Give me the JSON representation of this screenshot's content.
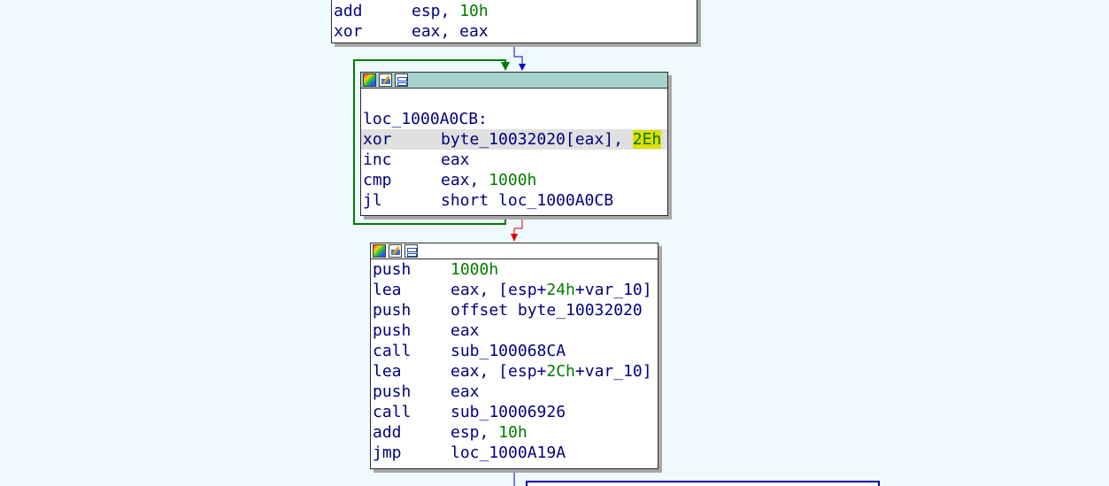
{
  "block_top": {
    "lines": [
      {
        "mnemonic": "add",
        "op1": "esp, ",
        "num": "10h",
        "op2": ""
      },
      {
        "mnemonic": "xor",
        "op1": "eax, eax",
        "num": "",
        "op2": ""
      }
    ]
  },
  "block_loop": {
    "label": "loc_1000A0CB:",
    "lines": [
      {
        "mnemonic": "xor",
        "op1": "byte_10032020[eax], ",
        "num": "2Eh",
        "op2": ""
      },
      {
        "mnemonic": "inc",
        "op1": "eax",
        "num": "",
        "op2": ""
      },
      {
        "mnemonic": "cmp",
        "op1": "eax, ",
        "num": "1000h",
        "op2": ""
      },
      {
        "mnemonic": "jl",
        "op1": "short loc_1000A0CB",
        "num": "",
        "op2": ""
      }
    ]
  },
  "block_bottom": {
    "lines": [
      {
        "mnemonic": "push",
        "op1": "",
        "num": "1000h",
        "op2": ""
      },
      {
        "mnemonic": "lea",
        "op1": "eax, [esp+",
        "num": "24h",
        "op2": "+var_10]"
      },
      {
        "mnemonic": "push",
        "op1": "offset byte_10032020",
        "num": "",
        "op2": ""
      },
      {
        "mnemonic": "push",
        "op1": "eax",
        "num": "",
        "op2": ""
      },
      {
        "mnemonic": "call",
        "op1": "sub_100068CA",
        "num": "",
        "op2": ""
      },
      {
        "mnemonic": "lea",
        "op1": "eax, [esp+",
        "num": "2Ch",
        "op2": "+var_10]"
      },
      {
        "mnemonic": "push",
        "op1": "eax",
        "num": "",
        "op2": ""
      },
      {
        "mnemonic": "call",
        "op1": "sub_10006926",
        "num": "",
        "op2": ""
      },
      {
        "mnemonic": "add",
        "op1": "esp, ",
        "num": "10h",
        "op2": ""
      },
      {
        "mnemonic": "jmp",
        "op1": "loc_1000A19A",
        "num": "",
        "op2": ""
      }
    ]
  },
  "colors": {
    "background": "#effaff",
    "edge_loop_back": "#007a00",
    "edge_unconditional": "#0000cc",
    "edge_false": "#e00000",
    "header_active": "#a8d4d0",
    "highlight_operand": "#dede00"
  },
  "icons": [
    "graph-color-icon",
    "rename-edit-icon",
    "graph-overview-icon"
  ]
}
